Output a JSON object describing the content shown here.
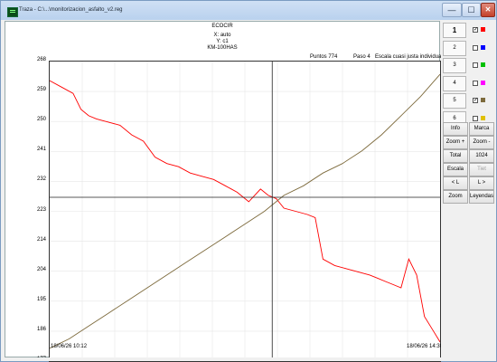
{
  "window": {
    "title": "Traza - C:\\...\\monitorizacion_asfalto_v2.reg",
    "min_glyph": "—",
    "max_glyph": "☐",
    "close_glyph": "✕"
  },
  "header": {
    "title": "ECOCIR",
    "x_label": "X: auto",
    "y_label": "Y: c1",
    "sensor": "KM-100HAS"
  },
  "info": {
    "puntos": "Puntos 774",
    "paso": "Paso 4",
    "escala": "Escala cuasi justa individual"
  },
  "chart_data": {
    "type": "line",
    "ylim": [
      174,
      268
    ],
    "yticks": [
      "268",
      "259",
      "250",
      "241",
      "232",
      "223",
      "214",
      "204",
      "195",
      "186",
      "177"
    ],
    "x_start_label": "18/06/26 10:12",
    "x_end_label": "18/06/26 14:30",
    "grid": true,
    "crosshair": {
      "x_fraction": 0.57,
      "y_value": 225.4
    },
    "series": [
      {
        "color": "#ff0000",
        "x": [
          0.0,
          0.03,
          0.06,
          0.08,
          0.1,
          0.12,
          0.15,
          0.18,
          0.21,
          0.24,
          0.27,
          0.3,
          0.33,
          0.36,
          0.39,
          0.42,
          0.45,
          0.48,
          0.51,
          0.54,
          0.56,
          0.58,
          0.6,
          0.63,
          0.66,
          0.68,
          0.7,
          0.73,
          0.76,
          0.79,
          0.82,
          0.84,
          0.86,
          0.88,
          0.9,
          0.92,
          0.94,
          0.96,
          0.98,
          1.0
        ],
        "values": [
          262,
          260,
          258,
          253,
          251,
          250,
          249,
          248,
          245,
          243,
          238,
          236,
          235,
          233,
          232,
          231,
          229,
          227,
          224,
          228,
          226,
          225,
          222,
          221,
          220,
          219,
          206,
          204,
          203,
          202,
          201,
          200,
          199,
          198,
          197,
          206,
          201,
          188,
          184,
          180
        ]
      },
      {
        "color": "#7d6a3c",
        "x": [
          0.0,
          0.05,
          0.1,
          0.15,
          0.2,
          0.25,
          0.3,
          0.35,
          0.4,
          0.45,
          0.5,
          0.55,
          0.6,
          0.65,
          0.7,
          0.75,
          0.8,
          0.85,
          0.9,
          0.95,
          1.0
        ],
        "values": [
          178,
          181,
          185,
          189,
          193,
          197,
          201,
          205,
          209,
          213,
          217,
          221,
          226,
          229,
          233,
          236,
          240,
          245,
          251,
          257,
          264
        ]
      }
    ]
  },
  "panel": {
    "traces": [
      {
        "num": "1",
        "checked": true,
        "color": "#ff0000"
      },
      {
        "num": "2",
        "checked": false,
        "color": "#0000ff"
      },
      {
        "num": "3",
        "checked": false,
        "color": "#00c000"
      },
      {
        "num": "4",
        "checked": false,
        "color": "#ff00ff"
      },
      {
        "num": "5",
        "checked": true,
        "color": "#7d6a3c"
      },
      {
        "num": "6",
        "checked": false,
        "color": "#e0c000"
      },
      {
        "num": "7",
        "checked": false,
        "color": "#00c0c0"
      },
      {
        "num": "8",
        "checked": false,
        "color": "#006000"
      }
    ],
    "check_glyph": "✓",
    "buttons": {
      "info": "Info",
      "marca": "Marca",
      "zoom_in": "Zoom +",
      "zoom_out": "Zoom -",
      "total": "Total",
      "points": "1024",
      "escala": "Escala",
      "tiet": "Tiet",
      "left": "< L",
      "right": "L >",
      "zoom": "Zoom",
      "leyendas": "Leyendas"
    }
  }
}
